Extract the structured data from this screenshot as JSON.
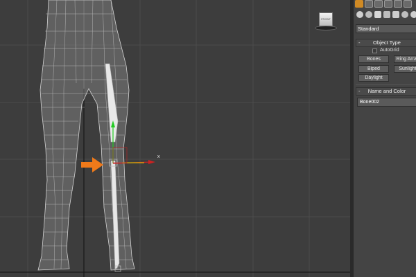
{
  "viewport": {
    "view_label": "FRONT",
    "x_axis_label": "x",
    "icons": [
      "viewcube-icon",
      "arrow-right-icon"
    ],
    "colors": {
      "background": "#3d3d3d",
      "mesh": "#d9d9d9",
      "bone": "#e8e8e8",
      "y_axis": "#22cc22",
      "x_axis": "#cc2222",
      "pointer": "#f07a1a"
    }
  },
  "command_panel": {
    "tab_icons": [
      "create-icon",
      "modify-icon",
      "hierarchy-icon",
      "motion-icon",
      "display-icon",
      "utilities-icon"
    ],
    "subcategory_icons": [
      "geometry-icon",
      "shapes-icon",
      "lights-icon",
      "cameras-icon",
      "helpers-icon",
      "spacewarps-icon",
      "systems-icon"
    ],
    "category_dropdown": "Standard",
    "object_type": {
      "title": "Object Type",
      "collapse": "-",
      "autogrid_label": "AutoGrid",
      "buttons": [
        "Bones",
        "Ring Array",
        "Biped",
        "Sunlight",
        "Daylight"
      ]
    },
    "name_and_color": {
      "title": "Name and Color",
      "collapse": "-",
      "name_value": "Bone002"
    }
  }
}
